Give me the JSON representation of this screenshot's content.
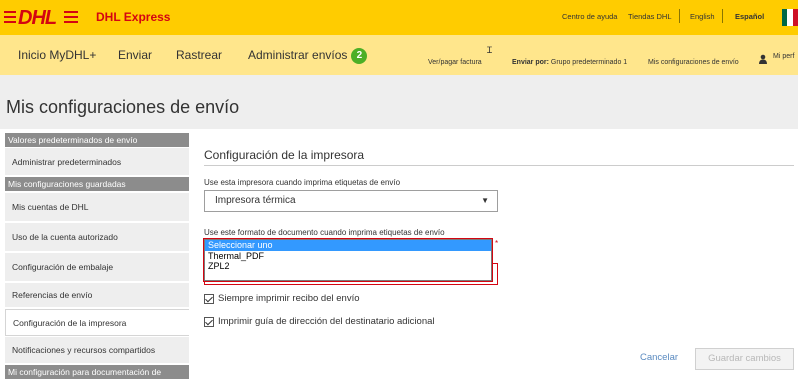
{
  "brand": {
    "logo_text": "DHL",
    "product": "DHL Express",
    "colors": {
      "yellow": "#ffcc00",
      "red": "#d40511"
    }
  },
  "utility": {
    "help": "Centro de ayuda",
    "stores": "Tiendas DHL",
    "lang_en": "English",
    "lang_es": "Español"
  },
  "nav": {
    "items": [
      "Inicio MyDHL+",
      "Enviar",
      "Rastrear",
      "Administrar envíos"
    ],
    "badge_count": "2",
    "invoice": "Ver/pagar factura",
    "ship_by_label": "Enviar por:",
    "ship_by_value": "Grupo predeterminado 1",
    "my_settings": "Mis configuraciones de envío",
    "profile": "Mi perf"
  },
  "page_title": "Mis configuraciones de envío",
  "sidebar": {
    "header1": "Valores predeterminados de envío",
    "item_defaults": "Administrar predeterminados",
    "header2": "Mis configuraciones guardadas",
    "items": [
      "Mis cuentas de DHL",
      "Uso de la cuenta autorizado",
      "Configuración de embalaje",
      "Referencias de envío",
      "Configuración de la impresora",
      "Notificaciones y recursos compartidos"
    ],
    "header3": "Mi configuración para documentación de"
  },
  "form": {
    "title": "Configuración de la impresora",
    "printer_label": "Use esta impresora cuando imprima etiquetas de envío",
    "printer_value": "Impresora térmica",
    "format_label": "Use este formato de documento cuando imprima etiquetas de envío",
    "format_options": [
      "Seleccionar uno",
      "Thermal_PDF",
      "ZPL2"
    ],
    "check_receipt": "Siempre imprimir recibo del envío",
    "check_guide": "Imprimir guía de dirección del destinatario adicional",
    "cancel": "Cancelar",
    "save": "Guardar cambios"
  }
}
